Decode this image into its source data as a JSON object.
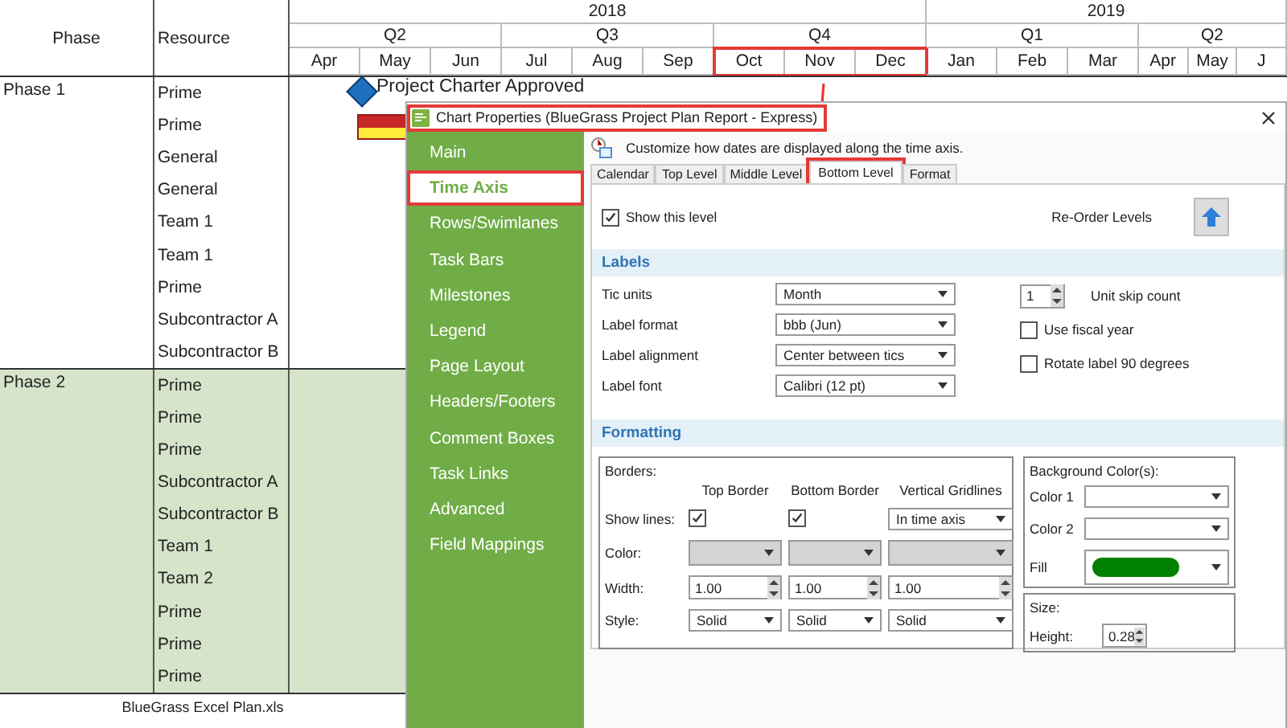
{
  "sheet": {
    "columns": [
      "Phase",
      "Resource"
    ],
    "years": [
      {
        "label": "2018",
        "quarters": [
          {
            "label": "Q2",
            "months": [
              "Apr",
              "May",
              "Jun"
            ],
            "highlighted": false
          },
          {
            "label": "Q3",
            "months": [
              "Jul",
              "Aug",
              "Sep"
            ],
            "highlighted": false
          },
          {
            "label": "Q4",
            "months": [
              "Oct",
              "Nov",
              "Dec"
            ],
            "highlighted": true
          }
        ]
      },
      {
        "label": "2019",
        "quarters": [
          {
            "label": "Q1",
            "months": [
              "Jan",
              "Feb",
              "Mar"
            ],
            "highlighted": false
          },
          {
            "label": "Q2",
            "months": [
              "Apr",
              "May",
              "J"
            ],
            "highlighted": false
          }
        ]
      }
    ],
    "phases": [
      {
        "label": "Phase 1",
        "shaded": false,
        "resources": [
          "Prime",
          "Prime",
          "General",
          "General",
          "Team 1",
          "Team 1",
          "Prime",
          "Subcontractor A",
          "Subcontractor B"
        ]
      },
      {
        "label": "Phase 2",
        "shaded": true,
        "resources": [
          "Prime",
          "Prime",
          "Prime",
          "Subcontractor A",
          "Subcontractor B",
          "Team 1",
          "Team 2",
          "Prime",
          "Prime",
          "Prime"
        ]
      }
    ],
    "milestone": {
      "label": "Project Charter Approved"
    },
    "footer": "BlueGrass Excel Plan.xls"
  },
  "dialog": {
    "title": "Chart Properties (BlueGrass Project Plan Report - Express)",
    "title_highlighted": true,
    "sidebar": [
      {
        "label": "Main",
        "selected": false,
        "highlighted": false
      },
      {
        "label": "Time Axis",
        "selected": true,
        "highlighted": true
      },
      {
        "label": "Rows/Swimlanes",
        "selected": false,
        "highlighted": false
      },
      {
        "label": "Task Bars",
        "selected": false,
        "highlighted": false
      },
      {
        "label": "Milestones",
        "selected": false,
        "highlighted": false
      },
      {
        "label": "Legend",
        "selected": false,
        "highlighted": false
      },
      {
        "label": "Page Layout",
        "selected": false,
        "highlighted": false
      },
      {
        "label": "Headers/Footers",
        "selected": false,
        "highlighted": false
      },
      {
        "label": "Comment Boxes",
        "selected": false,
        "highlighted": false
      },
      {
        "label": "Task Links",
        "selected": false,
        "highlighted": false
      },
      {
        "label": "Advanced",
        "selected": false,
        "highlighted": false
      },
      {
        "label": "Field Mappings",
        "selected": false,
        "highlighted": false
      }
    ],
    "hint": "Customize how dates are displayed along the time axis.",
    "tabs": [
      {
        "label": "Calendar",
        "selected": false,
        "highlighted": false
      },
      {
        "label": "Top Level",
        "selected": false,
        "highlighted": false
      },
      {
        "label": "Middle Level",
        "selected": false,
        "highlighted": false
      },
      {
        "label": "Bottom Level",
        "selected": true,
        "highlighted": true
      },
      {
        "label": "Format",
        "selected": false,
        "highlighted": false
      }
    ],
    "show_level": {
      "label": "Show this level",
      "checked": true
    },
    "reorder_label": "Re-Order Levels",
    "labels": {
      "title": "Labels",
      "fields": [
        {
          "label": "Tic units",
          "value": "Month"
        },
        {
          "label": "Label format",
          "value": "bbb (Jun)"
        },
        {
          "label": "Label alignment",
          "value": "Center between tics"
        },
        {
          "label": "Label font",
          "value": "Calibri (12 pt)"
        }
      ],
      "skip_count": {
        "value": "1",
        "caption": "Unit skip count"
      },
      "options": [
        {
          "kind": "checkbox",
          "label": "Use fiscal year",
          "checked": false
        },
        {
          "kind": "checkbox",
          "label": "Rotate label 90 degrees",
          "checked": false
        }
      ]
    },
    "formatting": {
      "title": "Formatting",
      "borders": {
        "title": "Borders:",
        "columns": [
          "Top Border",
          "Bottom Border",
          "Vertical Gridlines"
        ],
        "rows": [
          {
            "label": "Show lines:",
            "cells": [
              {
                "kind": "checkbox",
                "checked": true
              },
              {
                "kind": "checkbox",
                "checked": true
              },
              {
                "kind": "dropdown",
                "value": "In time axis"
              }
            ]
          },
          {
            "label": "Color:",
            "cells": [
              {
                "kind": "swatch"
              },
              {
                "kind": "swatch"
              },
              {
                "kind": "swatch"
              }
            ]
          },
          {
            "label": "Width:",
            "cells": [
              {
                "kind": "spinner",
                "value": "1.00"
              },
              {
                "kind": "spinner",
                "value": "1.00"
              },
              {
                "kind": "spinner",
                "value": "1.00"
              }
            ]
          },
          {
            "label": "Style:",
            "cells": [
              {
                "kind": "dropdown",
                "value": "Solid"
              },
              {
                "kind": "dropdown",
                "value": "Solid"
              },
              {
                "kind": "dropdown",
                "value": "Solid"
              }
            ]
          }
        ]
      },
      "background": {
        "title": "Background Color(s):",
        "rows": [
          {
            "label": "Color 1"
          },
          {
            "label": "Color 2"
          },
          {
            "label": "Fill",
            "color": "#008000"
          }
        ]
      },
      "size": {
        "title": "Size:",
        "label": "Height:",
        "value": "0.28"
      }
    }
  }
}
